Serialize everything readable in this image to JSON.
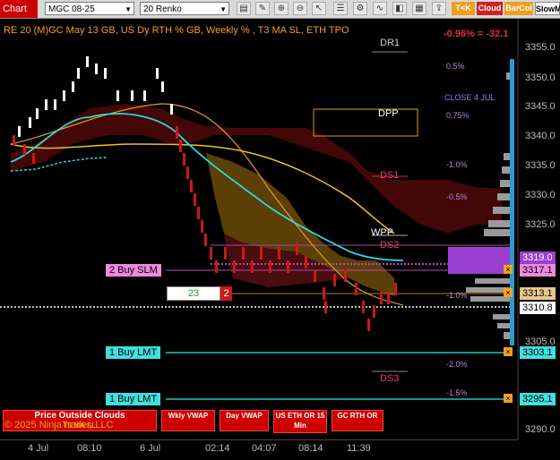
{
  "toolbar": {
    "chart_tab": "Chart",
    "instrument": "MGC 08-25",
    "bar_type": "20 Renko",
    "tko_label": "T<K",
    "cloud_label": "Cloud",
    "barcol_label": "BarCol",
    "slowm_label": "SlowM",
    "colors": {
      "tko": "#f0a020",
      "cloud": "#cc2222",
      "barcol": "#f0a020",
      "slowm": "#ffffff"
    }
  },
  "chart": {
    "title": "RE 20  (M)GC May 13 GB, US Dy RTH % GB, Weekly % , T3 MA SL, ETH TPO",
    "change_text": "-0.96% = -32.1",
    "copyright": "© 2025 NinjaTrader, LLC",
    "close_label": "CLOSE 4 JUL",
    "levels": {
      "dr1": "DR1",
      "dpp": "DPP",
      "ds1": "DS1",
      "wpp": "WPP",
      "ds2": "DS2",
      "ds3": "DS3"
    },
    "pct_labels": [
      "0.5%",
      "0.75%",
      "-1.0%",
      "-0.5%",
      "-1.0%",
      "-2.0%",
      "-1.5%"
    ],
    "price_axis": [
      "3355.0",
      "3350.0",
      "3345.0",
      "3340.0",
      "3335.0",
      "3330.0",
      "3325.0",
      "3305.0",
      "3290.0"
    ],
    "price_badges": {
      "p3319": "3319.0",
      "p3317": "3317.1",
      "p3313": "3313.1",
      "p3310": "3310.8",
      "p3303": "3303.1",
      "p3295": "3295.1"
    },
    "orders": {
      "buy_slm": "2 Buy SLM",
      "buy_lmt1": "1 Buy LMT",
      "buy_lmt2": "1 Buy LMT"
    },
    "position_box": {
      "count": "23",
      "qty": "2"
    },
    "time_axis": [
      "4 Jul",
      "08:10",
      "6 Jul",
      "02:14",
      "04:07",
      "08:14",
      "11:39"
    ],
    "buttons": {
      "price_outside": "Price Outside Clouds",
      "t3_ma_sl": "T3 MA SL",
      "wkly_vwap": "Wkly VWAP",
      "day_vwap": "Day VWAP",
      "us_eth": "US ETH OR 15 Min",
      "gc_rth": "GC RTH OR"
    }
  }
}
